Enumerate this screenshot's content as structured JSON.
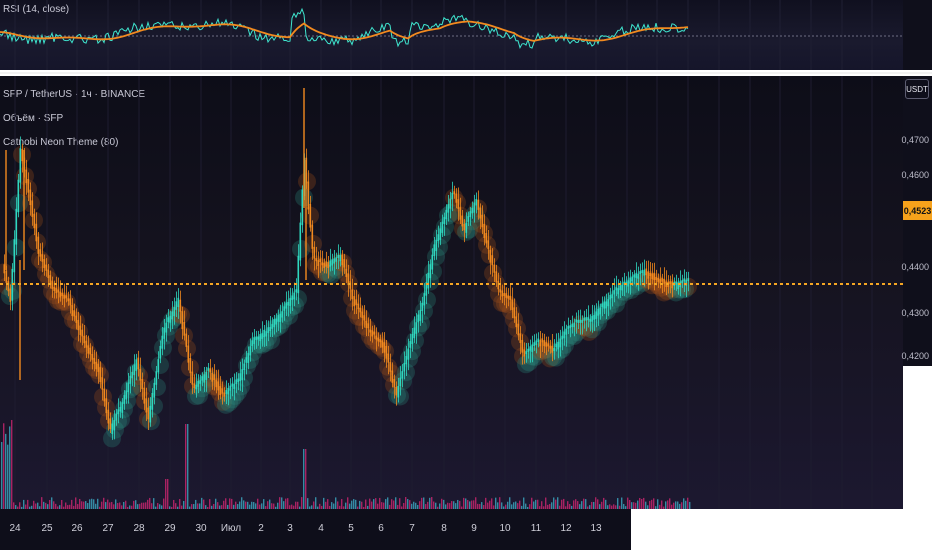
{
  "rsi": {
    "label": "RSI (14, close)",
    "rsi_color": "#3fe6cf",
    "ma_color": "#f28a1f"
  },
  "main": {
    "symbol_line": "SFP / TetherUS · 1ч · BINANCE",
    "volume_label": "Объём · SFP",
    "theme_label": "Catnobi Neon Theme (80)"
  },
  "price_scale": {
    "currency": "USDT",
    "levels": [
      "0,4700",
      "0,4600",
      "0,4400",
      "0,4300",
      "0,4200"
    ],
    "last_price": "0,4523",
    "last_price_color": "#f7a21b"
  },
  "time_axis": {
    "ticks": [
      "24",
      "25",
      "26",
      "27",
      "28",
      "29",
      "30",
      "Июл",
      "2",
      "3",
      "4",
      "5",
      "6",
      "7",
      "8",
      "9",
      "10",
      "11",
      "12",
      "13"
    ]
  },
  "colors": {
    "up": "#2fd9c0",
    "down": "#f28a1f",
    "glow_up": "#2a8f80",
    "glow_down": "#a8541a",
    "volume_up": "#3aa0b8",
    "volume_down": "#c2256b",
    "price_line": "#f5a623"
  }
}
